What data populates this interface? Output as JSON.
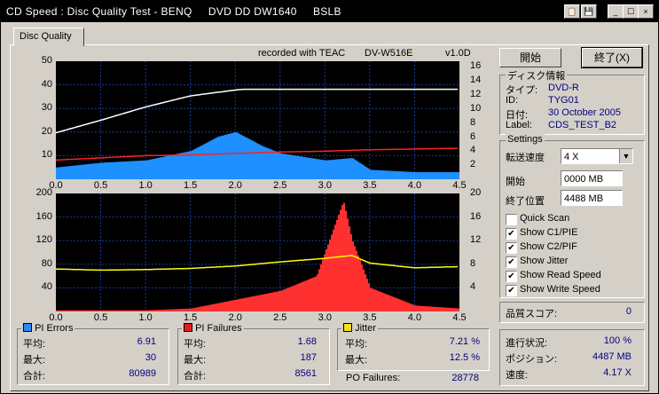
{
  "window": {
    "title": "CD Speed : Disc Quality Test - BENQ     DVD DD DW1640     BSLB",
    "buttons": [
      "📋",
      "💾",
      "_",
      "☐",
      "×"
    ]
  },
  "tab": {
    "label": "Disc Quality"
  },
  "header": {
    "recorded": "recorded with TEAC",
    "drive": "DV-W516E",
    "version": "v1.0D"
  },
  "charts": {
    "top": {
      "left_ticks": [
        "50",
        "40",
        "30",
        "20",
        "10"
      ],
      "right_ticks": [
        "16",
        "14",
        "12",
        "10",
        "8",
        "6",
        "4",
        "2"
      ],
      "x_ticks": [
        "0.0",
        "0.5",
        "1.0",
        "1.5",
        "2.0",
        "2.5",
        "3.0",
        "3.5",
        "4.0",
        "4.5"
      ]
    },
    "bottom": {
      "left_ticks": [
        "200",
        "160",
        "120",
        "80",
        "40"
      ],
      "right_ticks": [
        "20",
        "16",
        "12",
        "8",
        "4"
      ],
      "x_ticks": [
        "0.0",
        "0.5",
        "1.0",
        "1.5",
        "2.0",
        "2.5",
        "3.0",
        "3.5",
        "4.0",
        "4.5"
      ]
    }
  },
  "chart_data": [
    {
      "type": "bar",
      "description_series": "PI Errors (blue), read speed (white), write speed (red)",
      "x_range": [
        0,
        4.5
      ],
      "ylim_left": [
        0,
        50
      ],
      "ylim_right": [
        0,
        16
      ],
      "series": [
        {
          "name": "PI Errors",
          "color": "#1e90ff",
          "x": [
            0.0,
            0.5,
            1.0,
            1.5,
            1.8,
            2.0,
            2.3,
            2.5,
            3.0,
            3.3,
            3.5,
            4.0,
            4.5
          ],
          "values": [
            5,
            7,
            8,
            12,
            18,
            20,
            14,
            11,
            8,
            9,
            4,
            3,
            3
          ]
        },
        {
          "name": "Read Speed",
          "color": "#ffffff",
          "x": [
            0.0,
            0.5,
            1.0,
            1.5,
            2.0,
            2.1,
            2.5,
            3.0,
            3.5,
            4.0,
            4.5
          ],
          "values": [
            6.3,
            8.0,
            9.8,
            11.3,
            12.1,
            12.2,
            12.2,
            12.2,
            12.2,
            12.2,
            12.2
          ]
        },
        {
          "name": "Write Speed",
          "color": "#ff2020",
          "x": [
            0.0,
            0.5,
            1.0,
            1.5,
            2.0,
            2.5,
            3.0,
            3.5,
            4.0,
            4.5
          ],
          "values": [
            2.6,
            2.9,
            3.2,
            3.3,
            3.5,
            3.7,
            3.8,
            4.0,
            4.1,
            4.2
          ]
        }
      ]
    },
    {
      "type": "bar",
      "description_series": "PI Failures (red/green/yellow bars), Jitter (yellow line)",
      "x_range": [
        0,
        4.5
      ],
      "ylim_left": [
        0,
        200
      ],
      "ylim_right": [
        0,
        20
      ],
      "series": [
        {
          "name": "PI Failures",
          "color": "#ff3030",
          "x": [
            0.0,
            0.5,
            1.0,
            1.5,
            2.0,
            2.5,
            2.9,
            3.2,
            3.3,
            3.5,
            4.0,
            4.5
          ],
          "values": [
            2,
            2,
            2,
            5,
            20,
            35,
            60,
            187,
            120,
            40,
            10,
            5
          ]
        },
        {
          "name": "Jitter",
          "color": "#ffff00",
          "x": [
            0.0,
            0.5,
            1.0,
            1.5,
            2.0,
            2.5,
            3.0,
            3.3,
            3.5,
            4.0,
            4.5
          ],
          "values": [
            7.2,
            7.0,
            7.1,
            7.3,
            7.7,
            8.4,
            9.0,
            9.5,
            8.2,
            7.4,
            7.6
          ]
        }
      ]
    }
  ],
  "controls": {
    "start_button": "開始",
    "exit_button": "終了(X)"
  },
  "disc_info": {
    "title": "ディスク情報",
    "rows": [
      {
        "label": "タイプ:",
        "value": "DVD-R"
      },
      {
        "label": "ID:",
        "value": "TYG01"
      },
      {
        "label": "日付:",
        "value": "30 October 2005"
      },
      {
        "label": "Label:",
        "value": "CDS_TEST_B2"
      }
    ]
  },
  "settings": {
    "title": "Settings",
    "speed_label": "転送速度",
    "speed_value": "4 X",
    "start_label": "開始",
    "start_value": "0000 MB",
    "end_label": "終了位置",
    "end_value": "4488 MB",
    "checks": [
      {
        "label": "Quick Scan",
        "checked": false
      },
      {
        "label": "Show C1/PIE",
        "checked": true
      },
      {
        "label": "Show C2/PIF",
        "checked": true
      },
      {
        "label": "Show Jitter",
        "checked": true
      },
      {
        "label": "Show Read Speed",
        "checked": true
      },
      {
        "label": "Show Write Speed",
        "checked": true
      }
    ]
  },
  "quality": {
    "label": "品質スコア:",
    "value": "0"
  },
  "progress": {
    "rows": [
      {
        "label": "進行状況:",
        "value": "100 %"
      },
      {
        "label": "ポジション:",
        "value": "4487 MB"
      },
      {
        "label": "速度:",
        "value": "4.17 X"
      }
    ]
  },
  "pi_errors": {
    "title": "PI Errors",
    "color": "#2a8cf0",
    "rows": [
      {
        "label": "平均:",
        "value": "6.91"
      },
      {
        "label": "最大:",
        "value": "30"
      },
      {
        "label": "合計:",
        "value": "80989"
      }
    ]
  },
  "pi_failures": {
    "title": "PI Failures",
    "color": "#e02020",
    "rows": [
      {
        "label": "平均:",
        "value": "1.68"
      },
      {
        "label": "最大:",
        "value": "187"
      },
      {
        "label": "合計:",
        "value": "8561"
      }
    ]
  },
  "jitter": {
    "title": "Jitter",
    "color": "#f0e020",
    "rows": [
      {
        "label": "平均:",
        "value": "7.21 %"
      },
      {
        "label": "最大:",
        "value": "12.5 %"
      }
    ]
  },
  "po_failures": {
    "label": "PO Failures:",
    "value": "28778"
  }
}
